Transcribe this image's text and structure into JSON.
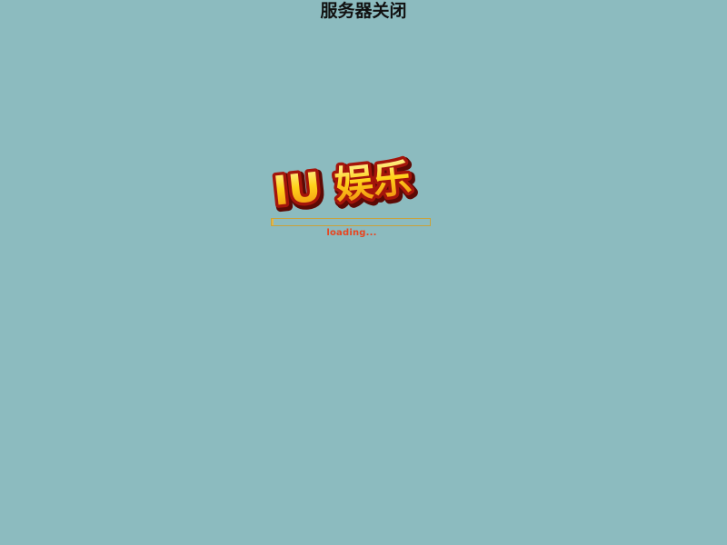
{
  "status": {
    "title": "服务器关闭"
  },
  "logo": {
    "text_latin": "IU",
    "text_cjk": "娱乐",
    "fill_color": "#ffd21a",
    "outline_color": "#a4150b",
    "shadow_color": "#5c0a05"
  },
  "loader": {
    "label": "loading...",
    "progress": 0.01,
    "border_color": "#c9a23a",
    "label_color": "#e8451f"
  },
  "colors": {
    "background": "#8cbbbf"
  }
}
